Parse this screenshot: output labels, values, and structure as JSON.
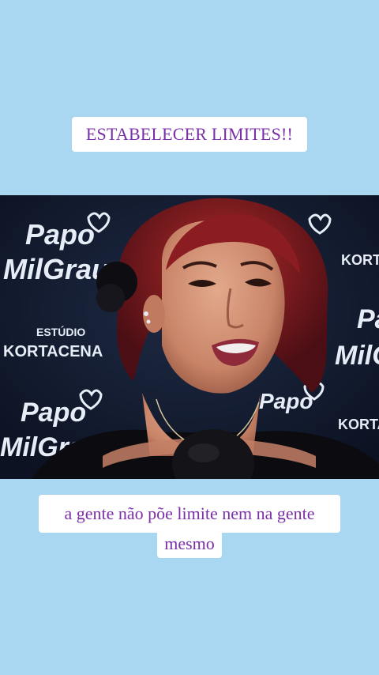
{
  "captions": {
    "title": "ESTABELECER LIMITES!!",
    "subtitle_line1": "a gente não põe limite nem na gente",
    "subtitle_line2": "mesmo"
  },
  "backdrop": {
    "brand_papo": "Papo",
    "brand_milgrau": "MilGrau",
    "studio_label": "ESTÚDIO",
    "studio_name": "KORTACENA"
  },
  "colors": {
    "page_background": "#a9d6f1",
    "caption_text": "#7a2fa8",
    "caption_box": "#ffffff",
    "backdrop": "#121a2e",
    "hair": "#8a1c22"
  }
}
